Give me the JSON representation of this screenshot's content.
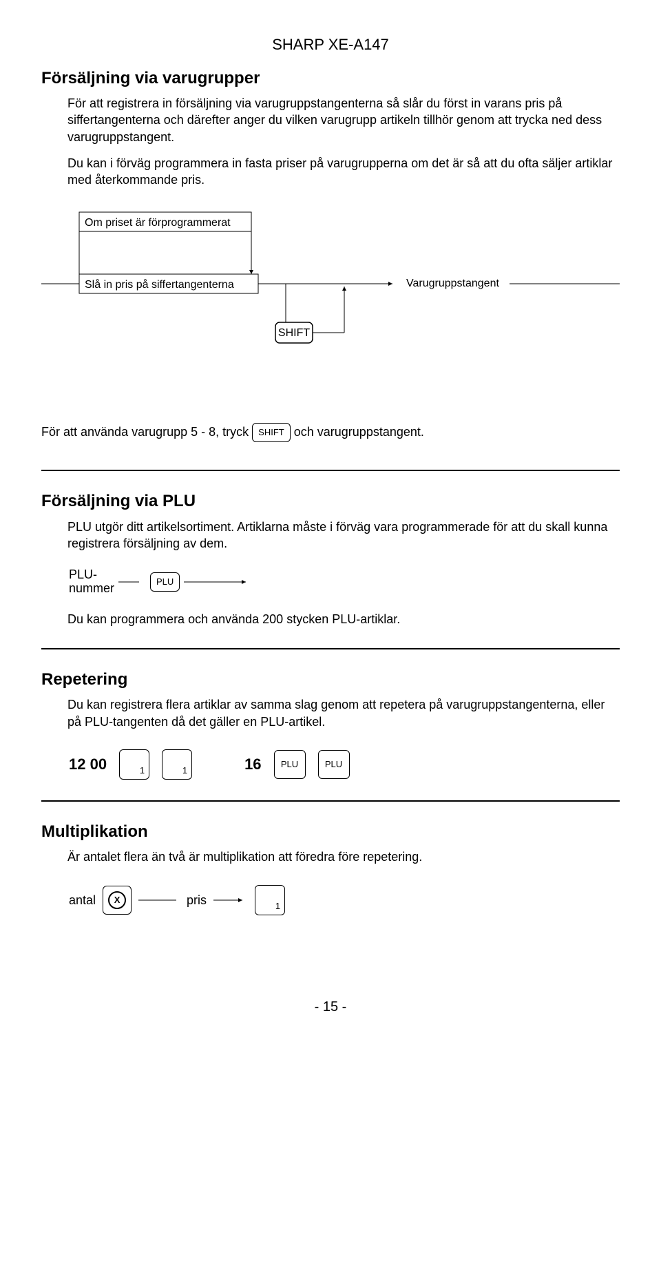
{
  "header": "SHARP XE-A147",
  "s1": {
    "heading": "Försäljning via varugrupper",
    "p1": "För att registrera in försäljning via varugruppstangenterna så slår du först in varans pris på siffertangenterna och därefter anger du vilken varugrupp artikeln tillhör genom att trycka ned dess varugruppstangent.",
    "p2": "Du kan i förväg programmera in fasta priser på varugrupperna om det är så att du ofta säljer artiklar med återkommande pris."
  },
  "diagram": {
    "box1": "Om priset är förprogrammerat",
    "box2": "Slå in pris på siffertangenterna",
    "shift": "SHIFT",
    "vg": "Varugruppstangent"
  },
  "shiftline": {
    "pre": "För att använda varugrupp 5 - 8, tryck",
    "key": "SHIFT",
    "post": "och varugruppstangent."
  },
  "s2": {
    "heading": "Försäljning via PLU",
    "p1": "PLU utgör ditt artikelsortiment. Artiklarna måste i förväg vara programmerade för att du skall kunna registrera försäljning av dem.",
    "plulabel1": "PLU-",
    "plulabel2": "nummer",
    "plukey": "PLU",
    "p2": "Du kan programmera och använda 200 stycken PLU-artiklar."
  },
  "s3": {
    "heading": "Repetering",
    "p1": "Du kan registrera flera artiklar av samma slag genom att repetera på varugruppstangenterna, eller på PLU-tangenten då det gäller en PLU-artikel.",
    "n1": "12 00",
    "k1": "1",
    "k2": "1",
    "n2": "16",
    "k3": "PLU",
    "k4": "PLU"
  },
  "s4": {
    "heading": "Multiplikation",
    "p1": "Är antalet flera än två är multiplikation att föredra före repetering.",
    "antal": "antal",
    "x": "X",
    "pris": "pris",
    "k1": "1"
  },
  "page": "- 15 -"
}
